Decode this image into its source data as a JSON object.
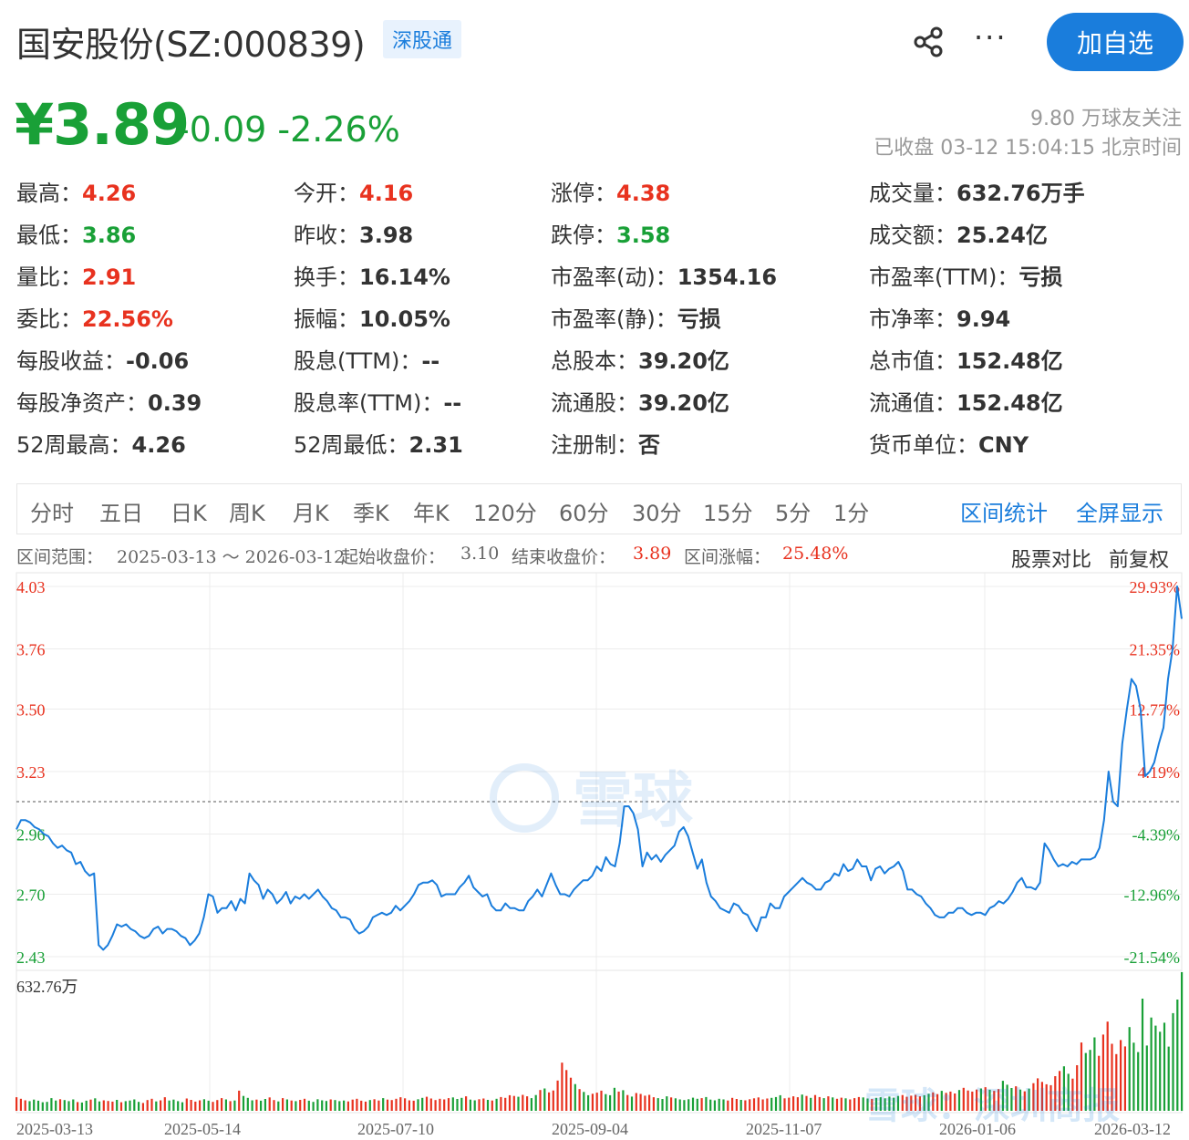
{
  "header": {
    "title": "国安股份(SZ:000839)",
    "badge": "深股通",
    "share_icon": "share-icon",
    "more_icon": "more-icon",
    "more_label": "···",
    "follow_label": "加自选"
  },
  "quote": {
    "price": "¥3.89",
    "change": "-0.09 -2.26%",
    "followers": "9.80 万球友关注",
    "status": "已收盘 03-12 15:04:15 北京时间"
  },
  "stats": [
    [
      {
        "label": "最高：",
        "value": "4.26",
        "color": "red"
      },
      {
        "label": "最低：",
        "value": "3.86",
        "color": "green"
      },
      {
        "label": "量比：",
        "value": "2.91",
        "color": "red"
      },
      {
        "label": "委比：",
        "value": "22.56%",
        "color": "red"
      },
      {
        "label": "每股收益：",
        "value": "-0.06",
        "color": ""
      },
      {
        "label": "每股净资产：",
        "value": "0.39",
        "color": ""
      },
      {
        "label": "52周最高：",
        "value": "4.26",
        "color": ""
      }
    ],
    [
      {
        "label": "今开：",
        "value": "4.16",
        "color": "red"
      },
      {
        "label": "昨收：",
        "value": "3.98",
        "color": ""
      },
      {
        "label": "换手：",
        "value": "16.14%",
        "color": ""
      },
      {
        "label": "振幅：",
        "value": "10.05%",
        "color": ""
      },
      {
        "label": "股息(TTM)：",
        "value": "--",
        "color": ""
      },
      {
        "label": "股息率(TTM)：",
        "value": "--",
        "color": ""
      },
      {
        "label": "52周最低：",
        "value": "2.31",
        "color": ""
      }
    ],
    [
      {
        "label": "涨停：",
        "value": "4.38",
        "color": "red"
      },
      {
        "label": "跌停：",
        "value": "3.58",
        "color": "green"
      },
      {
        "label": "市盈率(动)：",
        "value": "1354.16",
        "color": ""
      },
      {
        "label": "市盈率(静)：",
        "value": "亏损",
        "color": ""
      },
      {
        "label": "总股本：",
        "value": "39.20亿",
        "color": ""
      },
      {
        "label": "流通股：",
        "value": "39.20亿",
        "color": ""
      },
      {
        "label": "注册制：",
        "value": "否",
        "color": ""
      }
    ],
    [
      {
        "label": "成交量：",
        "value": "632.76万手",
        "color": ""
      },
      {
        "label": "成交额：",
        "value": "25.24亿",
        "color": ""
      },
      {
        "label": "市盈率(TTM)：",
        "value": "亏损",
        "color": ""
      },
      {
        "label": "市净率：",
        "value": "9.94",
        "color": ""
      },
      {
        "label": "总市值：",
        "value": "152.48亿",
        "color": ""
      },
      {
        "label": "流通值：",
        "value": "152.48亿",
        "color": ""
      },
      {
        "label": "货币单位：",
        "value": "CNY",
        "color": ""
      }
    ]
  ],
  "tabs": [
    "分时",
    "五日",
    "日K",
    "周K",
    "月K",
    "季K",
    "年K",
    "120分",
    "60分",
    "30分",
    "15分",
    "5分",
    "1分"
  ],
  "tab_links": [
    "区间统计",
    "全屏显示"
  ],
  "range": {
    "range_label": "区间范围：",
    "range_value": "2025-03-13 ～ 2026-03-12",
    "start_label": "起始收盘价：",
    "start_value": "3.10",
    "end_label": "结束收盘价：",
    "end_value": "3.89",
    "change_label": "区间涨幅：",
    "change_value": "25.48%",
    "compare_label": "股票对比",
    "adjust_label": "前复权"
  },
  "watermark": {
    "logo_text": "雪球",
    "corner_text": "雪球：深圳商报"
  },
  "colors": {
    "up": "#e8321f",
    "down": "#19a037",
    "line": "#1a7ddc",
    "accent": "#1a7ddc"
  },
  "chart_data": {
    "type": "line",
    "price_ticks": [
      "4.03",
      "3.76",
      "3.50",
      "3.23",
      "2.96",
      "2.70",
      "2.43"
    ],
    "price_tick_values": [
      4.03,
      3.76,
      3.5,
      3.23,
      2.96,
      2.7,
      2.43
    ],
    "pct_ticks": [
      "29.93%",
      "21.35%",
      "12.77%",
      "4.19%",
      "-4.39%",
      "-12.96%",
      "-21.54%"
    ],
    "base_price": 3.1,
    "ylim": [
      2.43,
      4.03
    ],
    "x_labels": [
      "2025-03-13",
      "2025-05-14",
      "2025-07-10",
      "2025-09-04",
      "2025-11-07",
      "2026-01-06",
      "2026-03-12"
    ],
    "volume_label": "632.76万",
    "volume_max": 632.76,
    "prices": [
      2.98,
      3.02,
      3.02,
      3.01,
      2.99,
      2.98,
      2.96,
      2.95,
      2.92,
      2.9,
      2.91,
      2.89,
      2.88,
      2.83,
      2.84,
      2.8,
      2.78,
      2.79,
      2.48,
      2.46,
      2.48,
      2.52,
      2.57,
      2.56,
      2.57,
      2.55,
      2.54,
      2.52,
      2.51,
      2.52,
      2.55,
      2.56,
      2.53,
      2.55,
      2.55,
      2.54,
      2.52,
      2.51,
      2.48,
      2.5,
      2.53,
      2.6,
      2.7,
      2.69,
      2.62,
      2.64,
      2.64,
      2.67,
      2.63,
      2.68,
      2.66,
      2.79,
      2.76,
      2.74,
      2.68,
      2.72,
      2.7,
      2.66,
      2.68,
      2.71,
      2.66,
      2.69,
      2.68,
      2.7,
      2.68,
      2.7,
      2.72,
      2.69,
      2.67,
      2.64,
      2.63,
      2.6,
      2.6,
      2.59,
      2.55,
      2.53,
      2.54,
      2.56,
      2.6,
      2.61,
      2.62,
      2.61,
      2.62,
      2.65,
      2.63,
      2.65,
      2.67,
      2.7,
      2.74,
      2.75,
      2.75,
      2.76,
      2.74,
      2.69,
      2.7,
      2.7,
      2.7,
      2.73,
      2.75,
      2.78,
      2.73,
      2.71,
      2.69,
      2.7,
      2.65,
      2.63,
      2.63,
      2.66,
      2.64,
      2.64,
      2.63,
      2.63,
      2.67,
      2.69,
      2.72,
      2.69,
      2.74,
      2.79,
      2.74,
      2.7,
      2.7,
      2.69,
      2.72,
      2.74,
      2.76,
      2.76,
      2.78,
      2.82,
      2.8,
      2.86,
      2.83,
      2.82,
      2.92,
      3.08,
      3.08,
      3.05,
      2.98,
      2.82,
      2.88,
      2.85,
      2.87,
      2.84,
      2.87,
      2.89,
      2.91,
      2.97,
      2.99,
      2.95,
      2.88,
      2.81,
      2.85,
      2.75,
      2.69,
      2.67,
      2.64,
      2.63,
      2.62,
      2.66,
      2.65,
      2.62,
      2.61,
      2.57,
      2.54,
      2.6,
      2.6,
      2.66,
      2.64,
      2.64,
      2.69,
      2.71,
      2.73,
      2.75,
      2.77,
      2.75,
      2.74,
      2.72,
      2.72,
      2.75,
      2.76,
      2.79,
      2.78,
      2.83,
      2.8,
      2.81,
      2.85,
      2.82,
      2.82,
      2.76,
      2.81,
      2.82,
      2.79,
      2.81,
      2.82,
      2.84,
      2.8,
      2.72,
      2.72,
      2.7,
      2.69,
      2.66,
      2.64,
      2.61,
      2.6,
      2.6,
      2.62,
      2.62,
      2.64,
      2.64,
      2.62,
      2.61,
      2.62,
      2.62,
      2.61,
      2.64,
      2.65,
      2.67,
      2.66,
      2.68,
      2.71,
      2.75,
      2.77,
      2.73,
      2.73,
      2.72,
      2.75,
      2.92,
      2.89,
      2.85,
      2.82,
      2.83,
      2.82,
      2.84,
      2.83,
      2.85,
      2.85,
      2.85,
      2.86,
      2.9,
      3.02,
      3.23,
      3.1,
      3.08,
      3.35,
      3.5,
      3.63,
      3.6,
      3.5,
      3.21,
      3.23,
      3.27,
      3.35,
      3.42,
      3.63,
      3.76,
      4.03,
      3.89
    ],
    "volumes": [
      62,
      55,
      48,
      44,
      51,
      46,
      39,
      41,
      58,
      47,
      53,
      49,
      44,
      52,
      40,
      38,
      46,
      51,
      57,
      43,
      48,
      45,
      42,
      50,
      39,
      44,
      47,
      52,
      41,
      36,
      49,
      55,
      43,
      48,
      62,
      47,
      51,
      44,
      39,
      56,
      50,
      42,
      48,
      53,
      46,
      41,
      49,
      58,
      52,
      44,
      47,
      92,
      68,
      59,
      48,
      51,
      46,
      54,
      61,
      49,
      43,
      58,
      52,
      47,
      44,
      50,
      55,
      46,
      41,
      53,
      48,
      45,
      52,
      49,
      44,
      47,
      43,
      51,
      55,
      46,
      42,
      49,
      53,
      47,
      58,
      51,
      49,
      55,
      62,
      57,
      48,
      46,
      53,
      59,
      64,
      56,
      49,
      55,
      52,
      58,
      61,
      54,
      59,
      66,
      51,
      48,
      53,
      56,
      50,
      47,
      55,
      63,
      59,
      71,
      68,
      64,
      73,
      66,
      58,
      72,
      95,
      102,
      84,
      93,
      138,
      220,
      186,
      151,
      122,
      99,
      86,
      71,
      78,
      83,
      92,
      76,
      71,
      105,
      88,
      94,
      72,
      65,
      81,
      77,
      69,
      73,
      62,
      58,
      54,
      66,
      61,
      57,
      52,
      49,
      53,
      60,
      55,
      58,
      63,
      51,
      48,
      55,
      52,
      47,
      59,
      54,
      50,
      48,
      53,
      57,
      61,
      52,
      56,
      59,
      63,
      71,
      57,
      60,
      66,
      62,
      74,
      68,
      59,
      72,
      63,
      58,
      66,
      61,
      55,
      60,
      57,
      52,
      58,
      63,
      61,
      56,
      54,
      59,
      62,
      57,
      65,
      60,
      68,
      72,
      64,
      69,
      73,
      66,
      71,
      78,
      84,
      76,
      91,
      82,
      88,
      79,
      95,
      105,
      93,
      88,
      97,
      102,
      108,
      96,
      91,
      99,
      137,
      119,
      104,
      112,
      97,
      89,
      101,
      126,
      148,
      132,
      121,
      117,
      158,
      182,
      203,
      169,
      147,
      208,
      312,
      264,
      278,
      335,
      251,
      348,
      407,
      306,
      259,
      323,
      294,
      382,
      311,
      268,
      512,
      298,
      426,
      389,
      361,
      402,
      293,
      446,
      508,
      632.76
    ]
  }
}
